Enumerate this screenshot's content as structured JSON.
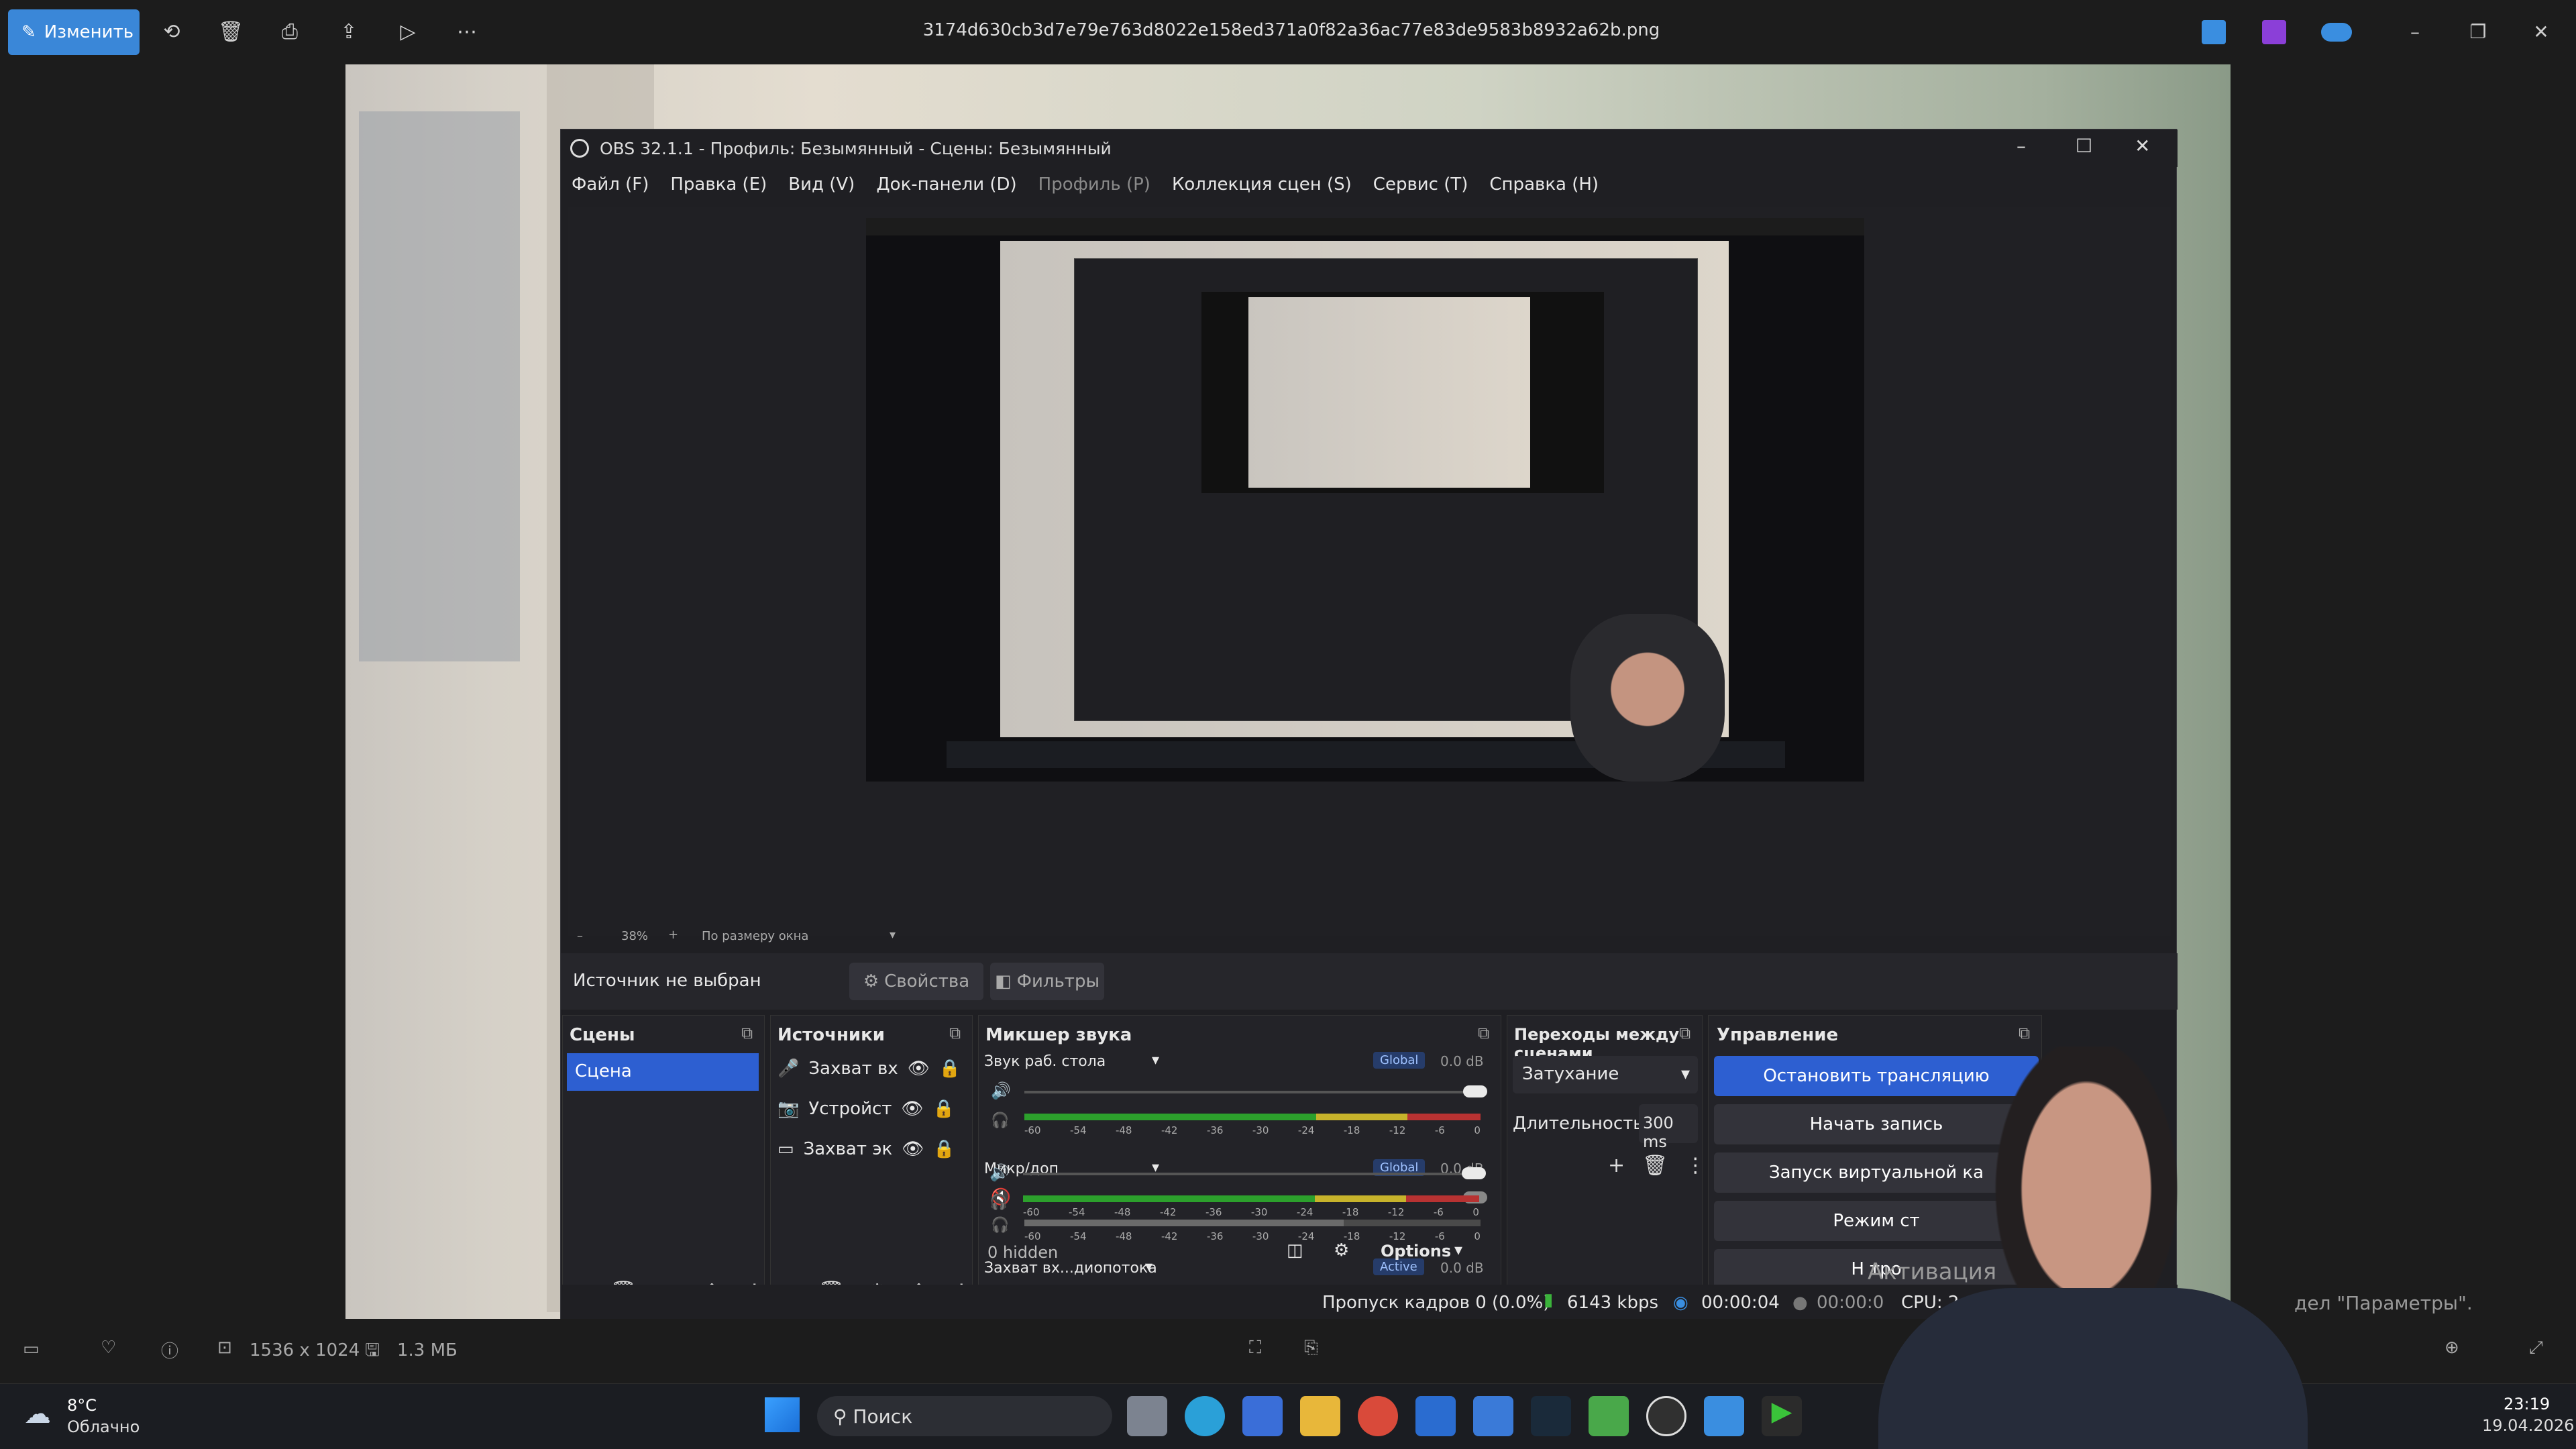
{
  "photos_app": {
    "edit_label": "Изменить",
    "file_name": "3174d630cb3d7e79e763d8022e158ed371a0f82a36ac77e83de9583b8932a62b.png",
    "info_dimensions": "1536 x 1024",
    "info_size": "1.3 МБ"
  },
  "obs": {
    "window_title": "OBS 32.1.1 - Профиль: Безымянный - Сцены: Безымянный",
    "menu": [
      "Файл (F)",
      "Правка (E)",
      "Вид (V)",
      "Док-панели (D)",
      "Профиль (P)",
      "Коллекция сцен (S)",
      "Сервис (T)",
      "Справка (H)"
    ],
    "zoom": "38%",
    "fit_mode": "По размеру окна",
    "no_source": "Источник не выбран",
    "properties_label": "Свойства",
    "filters_label": "Фильтры",
    "scenes": {
      "title": "Сцены",
      "items": [
        "Сцена"
      ]
    },
    "sources": {
      "title": "Источники",
      "items": [
        "Захват вх",
        "Устройст",
        "Захват эк"
      ]
    },
    "mixer": {
      "title": "Микшер звука",
      "channels": [
        {
          "name": "Звук раб. стола",
          "badge": "Global",
          "db": "0.0 dB"
        },
        {
          "name": "Микр/доп",
          "badge": "Global",
          "db": "0.0 dB"
        },
        {
          "name": "Захват вх...диопотока",
          "badge": "Active",
          "db": "0.0 dB"
        }
      ],
      "ticks": [
        "-60",
        "-54",
        "-48",
        "-42",
        "-36",
        "-30",
        "-24",
        "-18",
        "-12",
        "-6",
        "0"
      ],
      "hidden": "0 hidden",
      "options": "Options"
    },
    "transitions": {
      "title": "Переходы между сценами",
      "type": "Затухание",
      "duration_label": "Длительность",
      "duration": "300 ms"
    },
    "controls": {
      "title": "Управление",
      "stop_stream": "Остановить трансляцию",
      "start_record": "Начать запись",
      "virtual_cam": "Запуск виртуальной ка",
      "studio_mode": "Режим ст",
      "settings": "Н   тро"
    },
    "status": {
      "dropped": "Пропуск кадров 0 (0.0%)",
      "bitrate": "6143 kbps",
      "stream_time": "00:00:04",
      "record_time": "00:00:0",
      "cpu": "CPU: 2.",
      "activation": "Активация",
      "activation_hint": "дел \"Параметры\"."
    }
  },
  "taskbar": {
    "temperature": "8°C",
    "weather": "Облачно",
    "search": "Поиск",
    "time": "23:19",
    "date": "19.04.2026"
  }
}
